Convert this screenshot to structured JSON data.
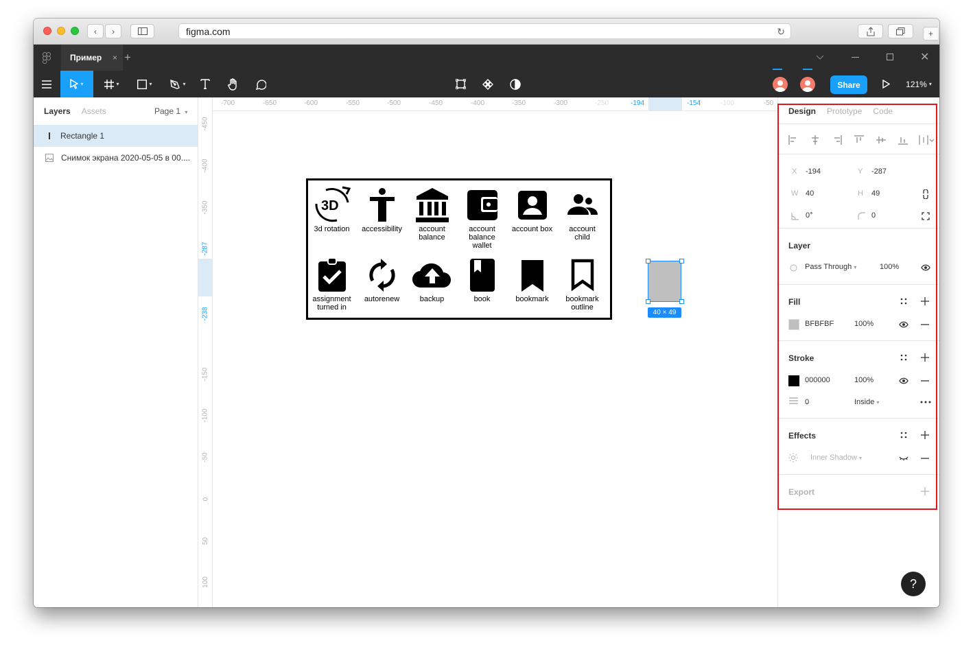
{
  "browser": {
    "url": "figma.com"
  },
  "tab": {
    "title": "Пример",
    "close": "×",
    "add": "+"
  },
  "toolbar": {
    "share_label": "Share",
    "zoom": "121%"
  },
  "left_panel": {
    "tabs": [
      "Layers",
      "Assets"
    ],
    "page": "Page 1",
    "layers": [
      "Rectangle 1",
      "Снимок экрана 2020-05-05 в 00...."
    ]
  },
  "ruler_top": [
    "-700",
    "-650",
    "-600",
    "-550",
    "-500",
    "-450",
    "-400",
    "-350",
    "-300",
    "-250",
    "-194",
    "-154",
    "-100",
    "-50"
  ],
  "ruler_left": [
    "-450",
    "-400",
    "-350",
    "-287",
    "-238",
    "-150",
    "-100",
    "-50",
    "0",
    "50",
    "100"
  ],
  "icons": [
    {
      "label1": "3d rotation",
      "label2": "",
      "label3": ""
    },
    {
      "label1": "accessibility",
      "label2": "",
      "label3": ""
    },
    {
      "label1": "account",
      "label2": "balance",
      "label3": ""
    },
    {
      "label1": "account",
      "label2": "balance",
      "label3": "wallet"
    },
    {
      "label1": "account box",
      "label2": "",
      "label3": ""
    },
    {
      "label1": "account",
      "label2": "child",
      "label3": ""
    },
    {
      "label1": "assignment",
      "label2": "turned in",
      "label3": ""
    },
    {
      "label1": "autorenew",
      "label2": "",
      "label3": ""
    },
    {
      "label1": "backup",
      "label2": "",
      "label3": ""
    },
    {
      "label1": "book",
      "label2": "",
      "label3": ""
    },
    {
      "label1": "bookmark",
      "label2": "",
      "label3": ""
    },
    {
      "label1": "bookmark",
      "label2": "outline",
      "label3": ""
    }
  ],
  "selection": {
    "dim_label": "40 × 49",
    "fill_color": "#BFBFBF",
    "accent": "#1A8CFF"
  },
  "design": {
    "tabs": [
      "Design",
      "Prototype",
      "Code"
    ],
    "x_label": "X",
    "x": "-194",
    "y_label": "Y",
    "y": "-287",
    "w_label": "W",
    "w": "40",
    "h_label": "H",
    "h": "49",
    "rotation": "0°",
    "radius": "0",
    "layer": {
      "title": "Layer",
      "blend": "Pass Through",
      "opacity": "100%"
    },
    "fill": {
      "title": "Fill",
      "hex": "BFBFBF",
      "opacity": "100%",
      "swatch": "#BFBFBF"
    },
    "stroke": {
      "title": "Stroke",
      "hex": "000000",
      "opacity": "100%",
      "swatch": "#000000",
      "weight": "0",
      "position": "Inside"
    },
    "effects": {
      "title": "Effects",
      "type": "Inner Shadow"
    },
    "export": {
      "title": "Export"
    }
  },
  "help": "?",
  "highlight_color": "#E8141C"
}
